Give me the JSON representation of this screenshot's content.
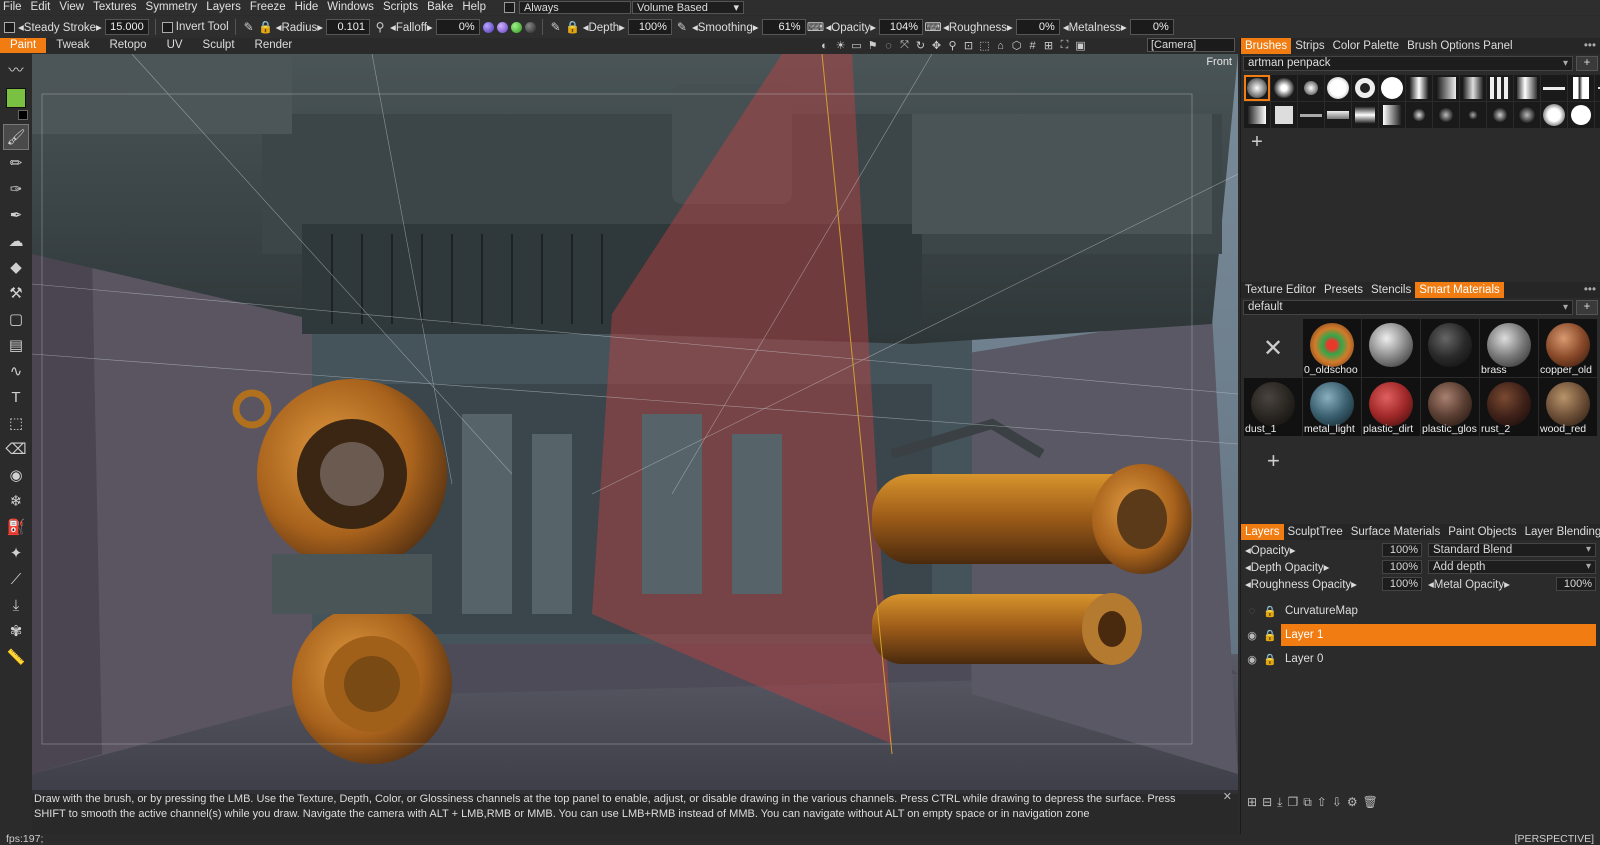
{
  "menu": [
    "File",
    "Edit",
    "View",
    "Textures",
    "Symmetry",
    "Layers",
    "Freeze",
    "Hide",
    "Windows",
    "Scripts",
    "Bake",
    "Help"
  ],
  "menu_combo_always": "Always",
  "menu_combo_volume": "Volume  Based",
  "toolbar": {
    "steady_stroke": "Steady  Stroke",
    "steady_value": "15.000",
    "invert_tool": "Invert  Tool",
    "radius": "Radius",
    "radius_value": "0.101",
    "falloff": "Falloff",
    "falloff_value": "0%",
    "depth": "Depth",
    "depth_value": "100%",
    "smoothing": "Smoothing",
    "smoothing_value": "61%",
    "opacity": "Opacity",
    "opacity_value": "104%",
    "roughness": "Roughness",
    "roughness_value": "0%",
    "metalness": "Metalness",
    "metalness_value": "0%"
  },
  "rooms": [
    "Paint",
    "Tweak",
    "Retopo",
    "UV",
    "Sculpt",
    "Render"
  ],
  "camera": "[Camera]",
  "viewport": {
    "view_label": "Front",
    "hint": "Draw with the brush, or by pressing the LMB. Use the Texture, Depth, Color, or Glossiness channels at the top panel to enable, adjust, or disable drawing in the various channels. Press CTRL while drawing to depress the surface. Press SHIFT to smooth the active channel(s) while you draw. Navigate the camera with ALT + LMB,RMB or MMB. You can use LMB+RMB instead of MMB. You can navigate without ALT on empty space or in navigation zone",
    "hint_close": "✕"
  },
  "status": {
    "fps": "fps:197;",
    "mode": "[PERSPECTIVE]"
  },
  "brushes_panel": {
    "tabs": [
      "Brushes",
      "Strips",
      "Color  Palette",
      "Brush  Options  Panel"
    ],
    "preset": "artman  penpack",
    "add": "+"
  },
  "smart_panel": {
    "tabs": [
      "Texture  Editor",
      "Presets",
      "Stencils",
      "Smart  Materials"
    ],
    "preset": "default",
    "add": "+",
    "materials": [
      {
        "name": "0_oldschoo",
        "color": "#c86b2a"
      },
      {
        "name": "",
        "color": "#9a9a9a"
      },
      {
        "name": "",
        "color": "#3a3a3a"
      },
      {
        "name": "brass",
        "color": "#8a8a86"
      },
      {
        "name": "copper_old",
        "color": "#8a5a3a"
      },
      {
        "name": "dust_1",
        "color": "#2a2826"
      },
      {
        "name": "metal_light",
        "color": "#3f6a7a"
      },
      {
        "name": "plastic_dirt",
        "color": "#a83030"
      },
      {
        "name": "plastic_glos",
        "color": "#6a4a3e"
      },
      {
        "name": "rust_2",
        "color": "#4a2a1e"
      },
      {
        "name": "wood_red",
        "color": "#7a5a40"
      }
    ]
  },
  "layers_panel": {
    "tabs": [
      "Layers",
      "SculptTree",
      "Surface  Materials",
      "Paint  Objects",
      "Layer  Blending"
    ],
    "opacity_label": "Opacity",
    "opacity_value": "100%",
    "opacity_blend": "Standard  Blend",
    "depth_label": "Depth  Opacity",
    "depth_value": "100%",
    "depth_blend": "Add  depth",
    "rough_label": "Roughness  Opacity",
    "rough_value": "100%",
    "metal_label": "Metal  Opacity",
    "metal_value": "100%",
    "layers": [
      {
        "name": "CurvatureMap",
        "active": false
      },
      {
        "name": "Layer  1",
        "active": true
      },
      {
        "name": "Layer  0",
        "active": false
      }
    ]
  },
  "colors": {
    "accent": "#f07c12",
    "primary_color": "#7ac142"
  }
}
